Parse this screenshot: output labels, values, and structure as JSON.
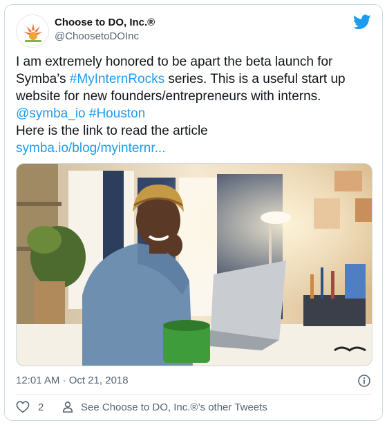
{
  "author": {
    "display_name": "Choose to DO, Inc.®",
    "handle": "@ChoosetoDOInc",
    "avatar_icon": "choose-to-do-logo"
  },
  "tweet": {
    "text_line1": "I am extremely honored to be apart the beta launch for",
    "text_line2_a": "Symba’s ",
    "hashtag1": "#MyInternRocks",
    "text_line2_b": " series. This is a useful start up",
    "text_line3": "website for new founders/entrepreneurs with interns.",
    "mention": "@symba_io",
    "hashtag2": "#Houston",
    "text_line5": "Here is the link to read the article",
    "link": "symba.io/blog/myinternr..."
  },
  "meta": {
    "timestamp": "12:01 AM · Oct 21, 2018"
  },
  "actions": {
    "like_count": "2",
    "other_tweets_label": "See Choose to DO, Inc.®’s other Tweets"
  },
  "colors": {
    "link": "#1d9bf0",
    "twitter_blue": "#1d9bf0",
    "secondary_text": "#536471"
  }
}
